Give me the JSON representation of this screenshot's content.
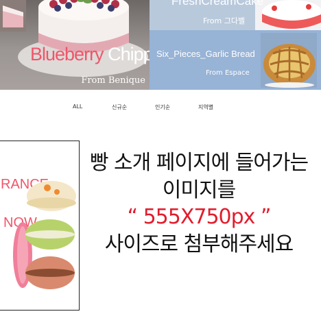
{
  "banners": {
    "main": {
      "title_pink": "Blueberry",
      "title_white": "Chippon",
      "subtitle": "From Benique"
    },
    "top_right": {
      "title": "FreshCreamCake",
      "subtitle": "From 그다벨"
    },
    "bread": {
      "title": "Six_Pieces_Garlic Bread",
      "subtitle": "From Espace"
    }
  },
  "nav": {
    "items": [
      {
        "label": "ALL"
      },
      {
        "label": "신규순"
      },
      {
        "label": "인기순"
      },
      {
        "label": "지역별"
      }
    ]
  },
  "product": {
    "text_line_1": "RANCE",
    "text_line_2": "NOW"
  },
  "notice": {
    "line_1": "빵 소개 페이지에 들어가는",
    "line_2": "이미지를",
    "line_3": "“ 555X750px ”",
    "line_4": "사이즈로 첨부해주세요"
  },
  "colors": {
    "accent_pink": "#f0556a",
    "notice_red": "#e21c2c",
    "banner_blue": "#97b3d6"
  }
}
